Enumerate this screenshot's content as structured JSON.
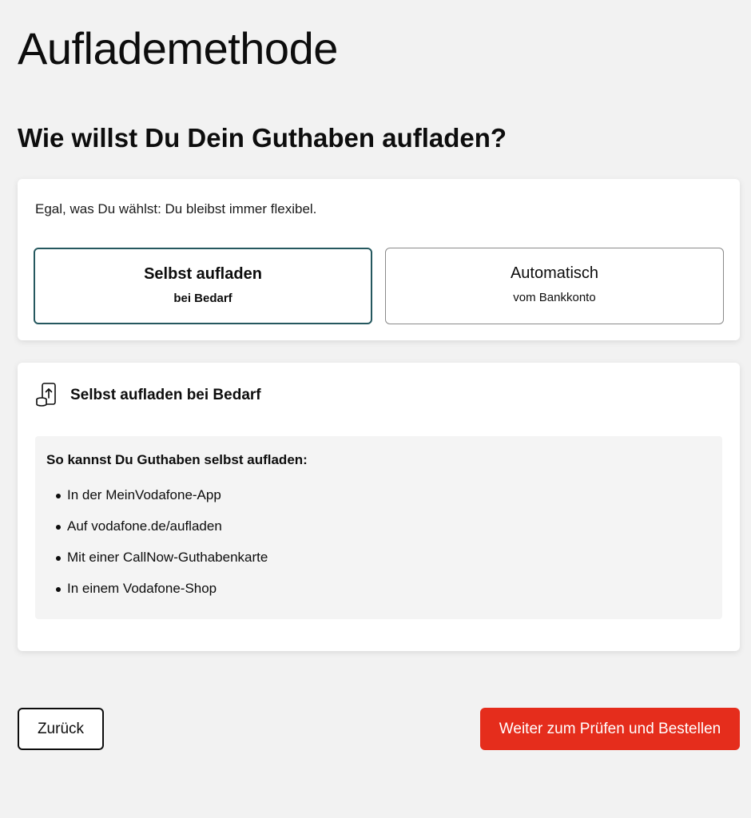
{
  "page": {
    "title": "Auflademethode",
    "question": "Wie willst Du Dein Guthaben aufladen?"
  },
  "options_card": {
    "intro": "Egal, was Du wählst: Du bleibst immer flexibel.",
    "options": [
      {
        "title": "Selbst aufladen",
        "subtitle": "bei Bedarf",
        "selected": true
      },
      {
        "title": "Automatisch",
        "subtitle": "vom Bankkonto",
        "selected": false
      }
    ]
  },
  "info_card": {
    "icon": "phone-topup-coins-icon",
    "title": "Selbst aufladen bei Bedarf",
    "ways_title": "So kannst Du Guthaben selbst aufladen:",
    "ways": [
      "In der MeinVodafone-App",
      "Auf vodafone.de/aufladen",
      "Mit einer CallNow-Guthabenkarte",
      "In einem Vodafone-Shop"
    ]
  },
  "actions": {
    "back_label": "Zurück",
    "next_label": "Weiter zum Prüfen und Bestellen"
  },
  "colors": {
    "background": "#f2f2f2",
    "selected_border": "#25585f",
    "primary_button": "#e52d1c"
  }
}
